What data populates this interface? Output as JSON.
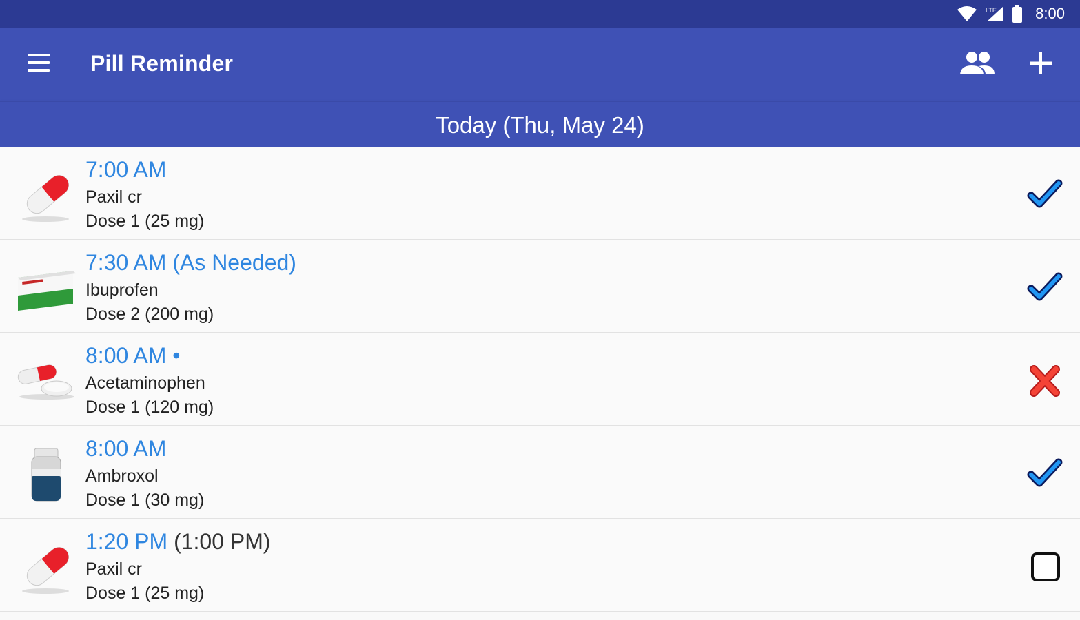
{
  "status_bar": {
    "time": "8:00",
    "icons": [
      "wifi-icon",
      "cell-signal-icon",
      "battery-icon"
    ]
  },
  "app_bar": {
    "title": "Pill Reminder",
    "icons": [
      "menu-icon",
      "people-icon",
      "add-icon"
    ]
  },
  "date_header": "Today (Thu, May 24)",
  "colors": {
    "primary": "#3f51b5",
    "status_bar": "#2c3a93",
    "time_text": "#2f86e0",
    "check": "#1565e0",
    "cross": "#e53935"
  },
  "reminders": [
    {
      "time": "7:00 AM",
      "extra": "",
      "name": "Paxil cr",
      "dose": "Dose 1 (25 mg)",
      "icon": "capsule-icon",
      "status": "taken"
    },
    {
      "time": "7:30 AM (As Needed)",
      "extra": "",
      "name": "Ibuprofen",
      "dose": "Dose 2 (200 mg)",
      "icon": "pill-box-icon",
      "status": "taken"
    },
    {
      "time": "8:00 AM •",
      "extra": "",
      "name": "Acetaminophen",
      "dose": "Dose 1 (120 mg)",
      "icon": "pills-icon",
      "status": "skipped"
    },
    {
      "time": "8:00 AM",
      "extra": "",
      "name": "Ambroxol",
      "dose": "Dose 1 (30 mg)",
      "icon": "bottle-icon",
      "status": "taken"
    },
    {
      "time": "1:20 PM",
      "extra": "(1:00 PM)",
      "name": "Paxil cr",
      "dose": "Dose 1 (25 mg)",
      "icon": "capsule-icon",
      "status": "pending"
    }
  ]
}
